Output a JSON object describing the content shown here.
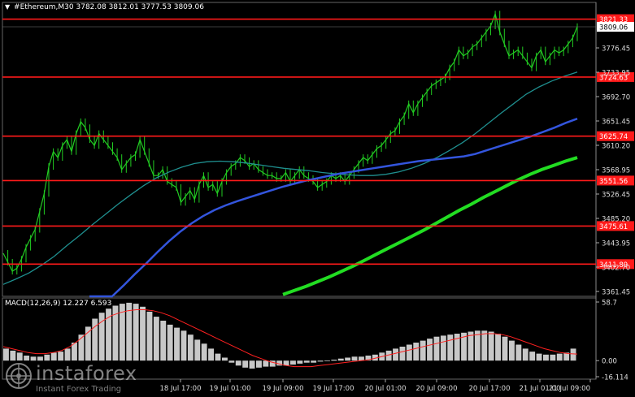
{
  "header": {
    "symbol": "#Ethereum,M30",
    "ohlc": "3782.08 3812.01 3777.53 3809.06"
  },
  "watermark": {
    "brand": "instaforex",
    "tagline": "Instant Forex Trading"
  },
  "colors": {
    "background": "#000000",
    "candle": "#22cc22",
    "level_line": "#ff1a1a",
    "ma_fast": "#1f8f8f",
    "ma_mid": "#3355dd",
    "ma_slow": "#22dd22",
    "macd_hist": "#c8c8c8",
    "macd_signal": "#ff2020",
    "price_tag": "#ffffff"
  },
  "chart_data": [
    {
      "type": "line",
      "name_hidden": "price",
      "title": "#Ethereum,M30",
      "x_tick_labels": [
        "18 Jul 17:00",
        "19 Jul 01:00",
        "19 Jul 09:00",
        "19 Jul 17:00",
        "20 Jul 01:00",
        "20 Jul 09:00",
        "20 Jul 17:00",
        "21 Jul 01:00",
        "21 Jul 09:00"
      ],
      "y_tick_labels": [
        "3776.45",
        "3733.95",
        "3692.70",
        "3651.45",
        "3610.20",
        "3568.95",
        "3526.45",
        "3485.20",
        "3443.95",
        "3402.70",
        "3361.45"
      ],
      "ylim": [
        3358,
        3848
      ],
      "current_price": {
        "label": "3809.06",
        "value": 3809.06
      },
      "levels": [
        {
          "label": "3821.33",
          "value": 3821.33
        },
        {
          "label": "3724.63",
          "value": 3724.63
        },
        {
          "label": "3625.74",
          "value": 3625.74
        },
        {
          "label": "3551.56",
          "value": 3551.56
        },
        {
          "label": "3475.61",
          "value": 3475.61
        },
        {
          "label": "3411.89",
          "value": 3411.89
        }
      ],
      "price_close": [
        3430,
        3415,
        3400,
        3405,
        3420,
        3440,
        3455,
        3470,
        3500,
        3530,
        3575,
        3600,
        3590,
        3610,
        3620,
        3600,
        3630,
        3650,
        3640,
        3620,
        3610,
        3630,
        3620,
        3610,
        3600,
        3590,
        3570,
        3580,
        3590,
        3595,
        3620,
        3600,
        3580,
        3560,
        3560,
        3570,
        3550,
        3545,
        3540,
        3515,
        3525,
        3535,
        3520,
        3545,
        3560,
        3540,
        3545,
        3530,
        3550,
        3565,
        3575,
        3580,
        3590,
        3585,
        3575,
        3580,
        3570,
        3565,
        3560,
        3560,
        3555,
        3555,
        3565,
        3550,
        3560,
        3570,
        3560,
        3555,
        3550,
        3540,
        3545,
        3550,
        3560,
        3555,
        3560,
        3550,
        3560,
        3570,
        3580,
        3590,
        3585,
        3595,
        3605,
        3610,
        3620,
        3630,
        3635,
        3650,
        3660,
        3680,
        3665,
        3680,
        3690,
        3700,
        3710,
        3715,
        3720,
        3725,
        3740,
        3750,
        3770,
        3760,
        3765,
        3775,
        3780,
        3790,
        3800,
        3810,
        3830,
        3800,
        3780,
        3760,
        3765,
        3770,
        3760,
        3750,
        3740,
        3760,
        3770,
        3750,
        3760,
        3770,
        3765,
        3770,
        3780,
        3790,
        3809.06
      ],
      "ma_fast": [
        3378,
        3387,
        3397,
        3410,
        3425,
        3443,
        3460,
        3478,
        3495,
        3512,
        3528,
        3543,
        3556,
        3566,
        3574,
        3580,
        3583,
        3584,
        3583,
        3581,
        3578,
        3575,
        3572,
        3570,
        3568,
        3565,
        3563,
        3561,
        3560,
        3560,
        3562,
        3566,
        3572,
        3580,
        3590,
        3602,
        3615,
        3630,
        3647,
        3664,
        3680,
        3696,
        3708,
        3718,
        3726,
        3733
      ],
      "ma_mid": [
        3324,
        3340,
        3358,
        3376,
        3395,
        3413,
        3432,
        3450,
        3466,
        3480,
        3492,
        3502,
        3510,
        3517,
        3523,
        3529,
        3535,
        3541,
        3546,
        3551,
        3555,
        3559,
        3563,
        3566,
        3569,
        3572,
        3575,
        3578,
        3581,
        3584,
        3586,
        3588,
        3590,
        3592,
        3596,
        3602,
        3608,
        3614,
        3620,
        3626,
        3633,
        3640,
        3648,
        3655
      ],
      "ma_slow": [
        3361,
        3368,
        3375,
        3383,
        3391,
        3400,
        3409,
        3419,
        3429,
        3439,
        3449,
        3459,
        3469,
        3480,
        3491,
        3502,
        3512,
        3523,
        3533,
        3543,
        3553,
        3562,
        3570,
        3577,
        3584,
        3590
      ]
    },
    {
      "type": "bar",
      "title": "MACD(12,26,9) 12.227 6.593",
      "y_tick_labels": [
        "58.7",
        "0.00",
        "-16.114"
      ],
      "ylim": [
        -16.114,
        58.7
      ],
      "histogram": [
        12,
        10,
        8,
        5,
        4,
        4,
        6,
        8,
        9,
        12,
        18,
        26,
        34,
        42,
        48,
        52,
        55,
        57,
        58,
        57,
        54,
        49,
        44,
        40,
        36,
        33,
        30,
        26,
        21,
        17,
        12,
        7,
        3,
        -2,
        -5,
        -7,
        -8,
        -7,
        -6,
        -6,
        -5,
        -5,
        -4,
        -3,
        -2,
        -2,
        -1,
        0,
        1,
        2,
        3,
        4,
        4,
        5,
        6,
        8,
        10,
        12,
        14,
        16,
        18,
        20,
        22,
        24,
        25,
        26,
        27,
        28,
        29,
        30,
        30,
        29,
        27,
        24,
        20,
        16,
        12,
        9,
        7,
        6,
        6,
        7,
        8,
        12
      ],
      "signal": [
        14,
        12,
        10,
        8,
        7,
        7,
        8,
        10,
        14,
        20,
        27,
        34,
        40,
        45,
        48,
        50,
        51,
        51,
        50,
        48,
        45,
        41,
        37,
        33,
        29,
        25,
        21,
        17,
        13,
        9,
        5,
        2,
        -1,
        -3,
        -5,
        -6,
        -6,
        -6,
        -5,
        -4,
        -3,
        -2,
        -1,
        0,
        1,
        3,
        5,
        7,
        9,
        11,
        13,
        15,
        17,
        19,
        21,
        23,
        25,
        26,
        27,
        27,
        26,
        24,
        21,
        18,
        15,
        12,
        10,
        8,
        7,
        6.6
      ]
    }
  ]
}
